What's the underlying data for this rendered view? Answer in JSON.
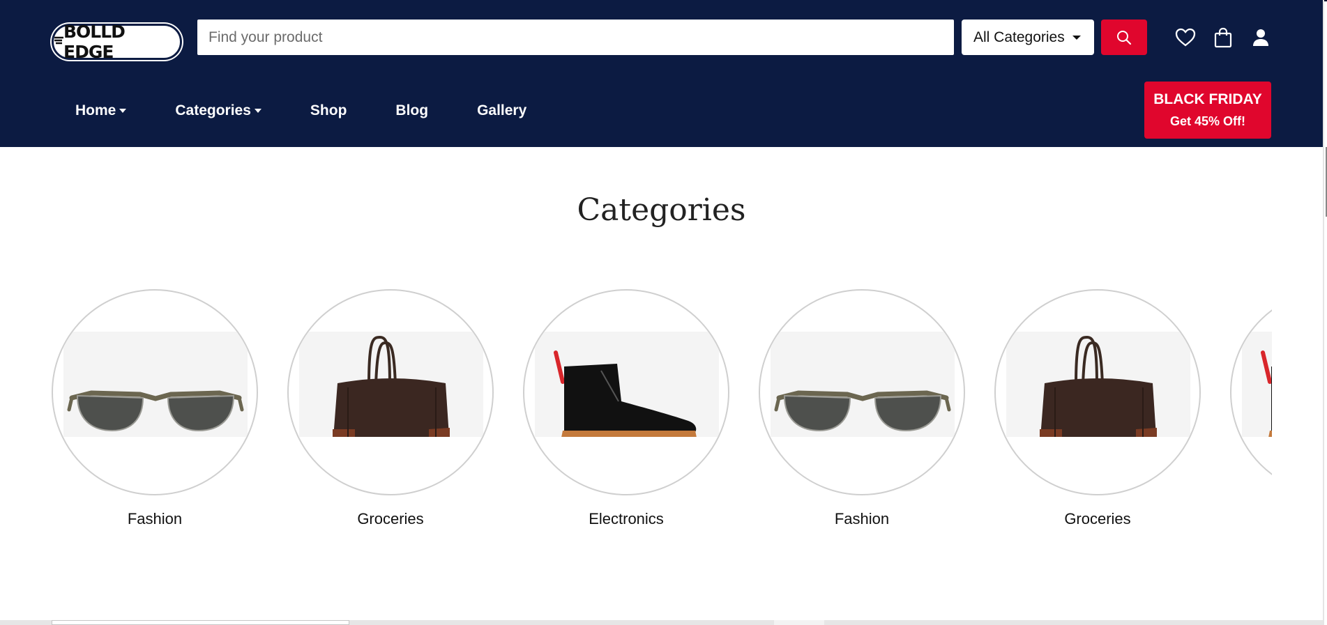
{
  "brand": {
    "logo_text": "BOLLD EDGE"
  },
  "search": {
    "placeholder": "Find your product"
  },
  "category_select": {
    "selected": "All Categories"
  },
  "nav": [
    {
      "label": "Home",
      "has_dropdown": true
    },
    {
      "label": "Categories",
      "has_dropdown": true
    },
    {
      "label": "Shop",
      "has_dropdown": false
    },
    {
      "label": "Blog",
      "has_dropdown": false
    },
    {
      "label": "Gallery",
      "has_dropdown": false
    }
  ],
  "promo": {
    "line1": "BLACK FRIDAY",
    "line2": "Get 45% Off!"
  },
  "header_icons": [
    "heart-icon",
    "shopping-bag-icon",
    "user-icon"
  ],
  "section": {
    "title": "Categories"
  },
  "categories": [
    {
      "label": "Fashion",
      "image": "sunglasses"
    },
    {
      "label": "Groceries",
      "image": "leather-bag"
    },
    {
      "label": "Electronics",
      "image": "leather-boot"
    },
    {
      "label": "Fashion",
      "image": "sunglasses"
    },
    {
      "label": "Groceries",
      "image": "leather-bag"
    },
    {
      "label": "",
      "image": "leather-boot"
    }
  ],
  "colors": {
    "header_bg": "#0c1b42",
    "accent_red": "#e0062d",
    "text_dark": "#111111",
    "circle_border": "#cfcfcf"
  }
}
